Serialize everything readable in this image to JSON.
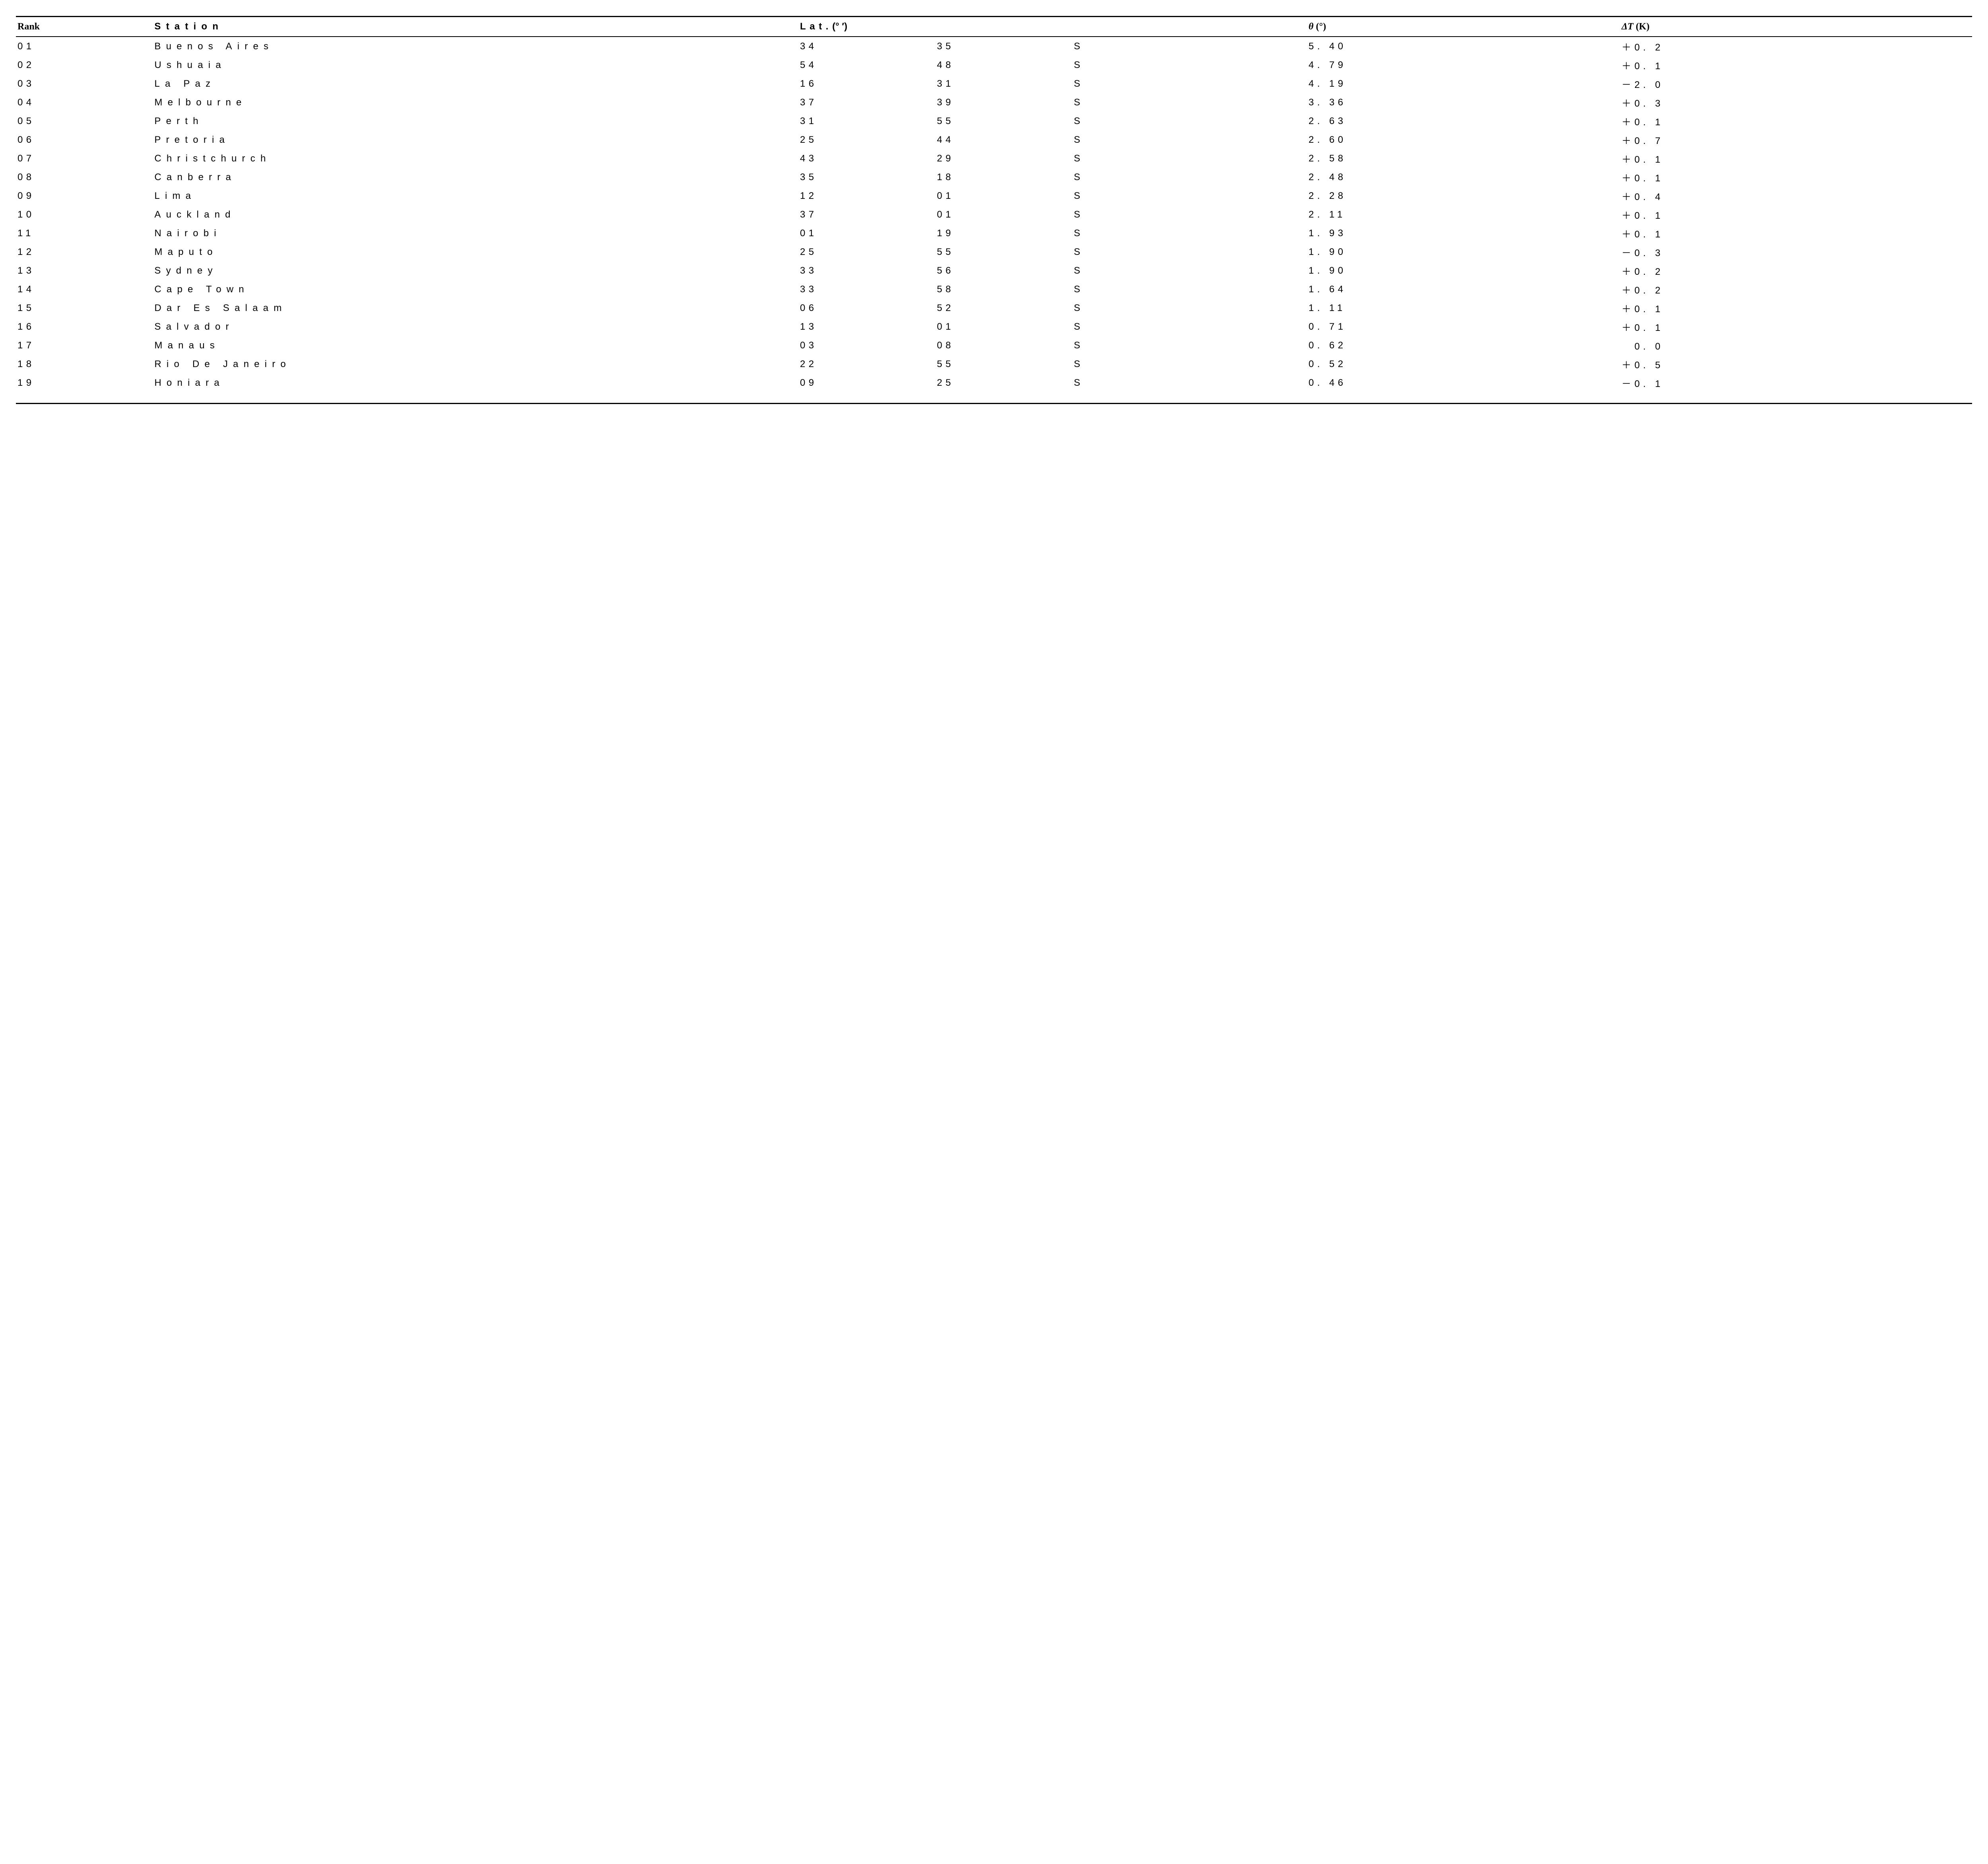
{
  "headers": {
    "rank": "Rank",
    "station": "Station",
    "lat_prefix": "Lat.",
    "lat_unit": "(°  ′)",
    "theta_sym": "θ",
    "theta_unit": " (°)",
    "dt_sym": "ΔT",
    "dt_unit": " (K)"
  },
  "rows": [
    {
      "rank": "01",
      "station": "Buenos Aires",
      "lat_deg": "34",
      "lat_min": "35",
      "hemi": "S",
      "theta": "5. 40",
      "dt": "＋0. 2"
    },
    {
      "rank": "02",
      "station": "Ushuaia",
      "lat_deg": "54",
      "lat_min": "48",
      "hemi": "S",
      "theta": "4. 79",
      "dt": "＋0. 1"
    },
    {
      "rank": "03",
      "station": "La Paz",
      "lat_deg": "16",
      "lat_min": "31",
      "hemi": "S",
      "theta": "4. 19",
      "dt": "－2. 0"
    },
    {
      "rank": "04",
      "station": "Melbourne",
      "lat_deg": "37",
      "lat_min": "39",
      "hemi": "S",
      "theta": "3. 36",
      "dt": "＋0. 3"
    },
    {
      "rank": "05",
      "station": "Perth",
      "lat_deg": "31",
      "lat_min": "55",
      "hemi": "S",
      "theta": "2. 63",
      "dt": "＋0. 1"
    },
    {
      "rank": "06",
      "station": "Pretoria",
      "lat_deg": "25",
      "lat_min": "44",
      "hemi": "S",
      "theta": "2. 60",
      "dt": "＋0. 7"
    },
    {
      "rank": "07",
      "station": "Christchurch",
      "lat_deg": "43",
      "lat_min": "29",
      "hemi": "S",
      "theta": "2. 58",
      "dt": "＋0. 1"
    },
    {
      "rank": "08",
      "station": "Canberra",
      "lat_deg": "35",
      "lat_min": "18",
      "hemi": "S",
      "theta": "2. 48",
      "dt": "＋0. 1"
    },
    {
      "rank": "09",
      "station": "Lima",
      "lat_deg": "12",
      "lat_min": "01",
      "hemi": "S",
      "theta": "2. 28",
      "dt": "＋0. 4"
    },
    {
      "rank": "10",
      "station": "Auckland",
      "lat_deg": "37",
      "lat_min": "01",
      "hemi": "S",
      "theta": "2. 11",
      "dt": "＋0. 1"
    },
    {
      "rank": "11",
      "station": "Nairobi",
      "lat_deg": "01",
      "lat_min": "19",
      "hemi": "S",
      "theta": "1. 93",
      "dt": "＋0. 1"
    },
    {
      "rank": "12",
      "station": "Maputo",
      "lat_deg": "25",
      "lat_min": "55",
      "hemi": "S",
      "theta": "1. 90",
      "dt": "－0. 3"
    },
    {
      "rank": "13",
      "station": "Sydney",
      "lat_deg": "33",
      "lat_min": "56",
      "hemi": "S",
      "theta": "1. 90",
      "dt": "＋0. 2"
    },
    {
      "rank": "14",
      "station": "Cape Town",
      "lat_deg": "33",
      "lat_min": "58",
      "hemi": "S",
      "theta": "1. 64",
      "dt": "＋0. 2"
    },
    {
      "rank": "15",
      "station": "Dar Es Salaam",
      "lat_deg": "06",
      "lat_min": "52",
      "hemi": "S",
      "theta": "1. 11",
      "dt": "＋0. 1"
    },
    {
      "rank": "16",
      "station": "Salvador",
      "lat_deg": "13",
      "lat_min": "01",
      "hemi": "S",
      "theta": "0. 71",
      "dt": "＋0. 1"
    },
    {
      "rank": "17",
      "station": "Manaus",
      "lat_deg": "03",
      "lat_min": "08",
      "hemi": "S",
      "theta": "0. 62",
      "dt": "　0. 0"
    },
    {
      "rank": "18",
      "station": "Rio De Janeiro",
      "lat_deg": "22",
      "lat_min": "55",
      "hemi": "S",
      "theta": "0. 52",
      "dt": "＋0. 5"
    },
    {
      "rank": "19",
      "station": "Honiara",
      "lat_deg": "09",
      "lat_min": "25",
      "hemi": "S",
      "theta": "0. 46",
      "dt": "－0. 1"
    }
  ]
}
